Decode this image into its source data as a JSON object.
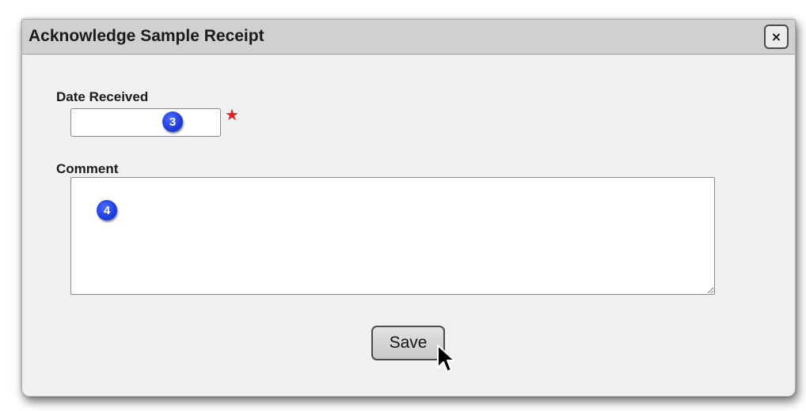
{
  "dialog": {
    "title": "Acknowledge Sample Receipt",
    "close_label": "×"
  },
  "form": {
    "date_received": {
      "label": "Date Received",
      "value": "",
      "required_marker": "★",
      "callout_number": "3"
    },
    "comment": {
      "label": "Comment",
      "value": "",
      "callout_number": "4"
    }
  },
  "actions": {
    "save_label": "Save"
  },
  "colors": {
    "titlebar": "#d0d0d0",
    "dialog_background": "#f0f0f0",
    "required_marker": "#e32020",
    "callout_badge": "#1f3fe0"
  },
  "icons": {
    "close": "close-icon",
    "cursor": "mouse-pointer-icon"
  }
}
